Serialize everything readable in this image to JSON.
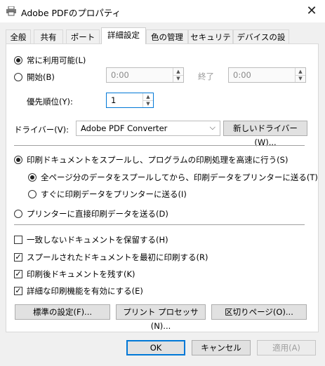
{
  "window": {
    "title": "Adobe PDFのプロパティ"
  },
  "tabs": [
    "全般",
    "共有",
    "ポート",
    "詳細設定",
    "色の管理",
    "セキュリティ",
    "デバイスの設定"
  ],
  "availability": {
    "always_label": "常に利用可能(L)",
    "from_label": "開始(B)",
    "from_time": "0:00",
    "until_label": "終了",
    "until_time": "0:00"
  },
  "priority": {
    "label": "優先順位(Y):",
    "value": "1"
  },
  "driver": {
    "label": "ドライバー(V):",
    "selected": "Adobe PDF Converter",
    "new_button": "新しいドライバー(W)..."
  },
  "spool": {
    "spool_label": "印刷ドキュメントをスプールし、プログラムの印刷処理を高速に行う(S)",
    "start_after_last_label": "全ページ分のデータをスプールしてから、印刷データをプリンターに送る(T)",
    "start_immediately_label": "すぐに印刷データをプリンターに送る(I)",
    "direct_label": "プリンターに直接印刷データを送る(D)"
  },
  "options": [
    {
      "label": "一致しないドキュメントを保留する(H)",
      "checked": false
    },
    {
      "label": "スプールされたドキュメントを最初に印刷する(R)",
      "checked": true
    },
    {
      "label": "印刷後ドキュメントを残す(K)",
      "checked": true
    },
    {
      "label": "詳細な印刷機能を有効にする(E)",
      "checked": true
    }
  ],
  "panel_buttons": {
    "defaults": "標準の設定(F)...",
    "processor": "プリント プロセッサ(N)...",
    "separator_page": "区切りページ(O)..."
  },
  "footer": {
    "ok": "OK",
    "cancel": "キャンセル",
    "apply": "適用(A)"
  },
  "icons": {
    "title_icon": "printer-icon",
    "close": "close-icon"
  }
}
